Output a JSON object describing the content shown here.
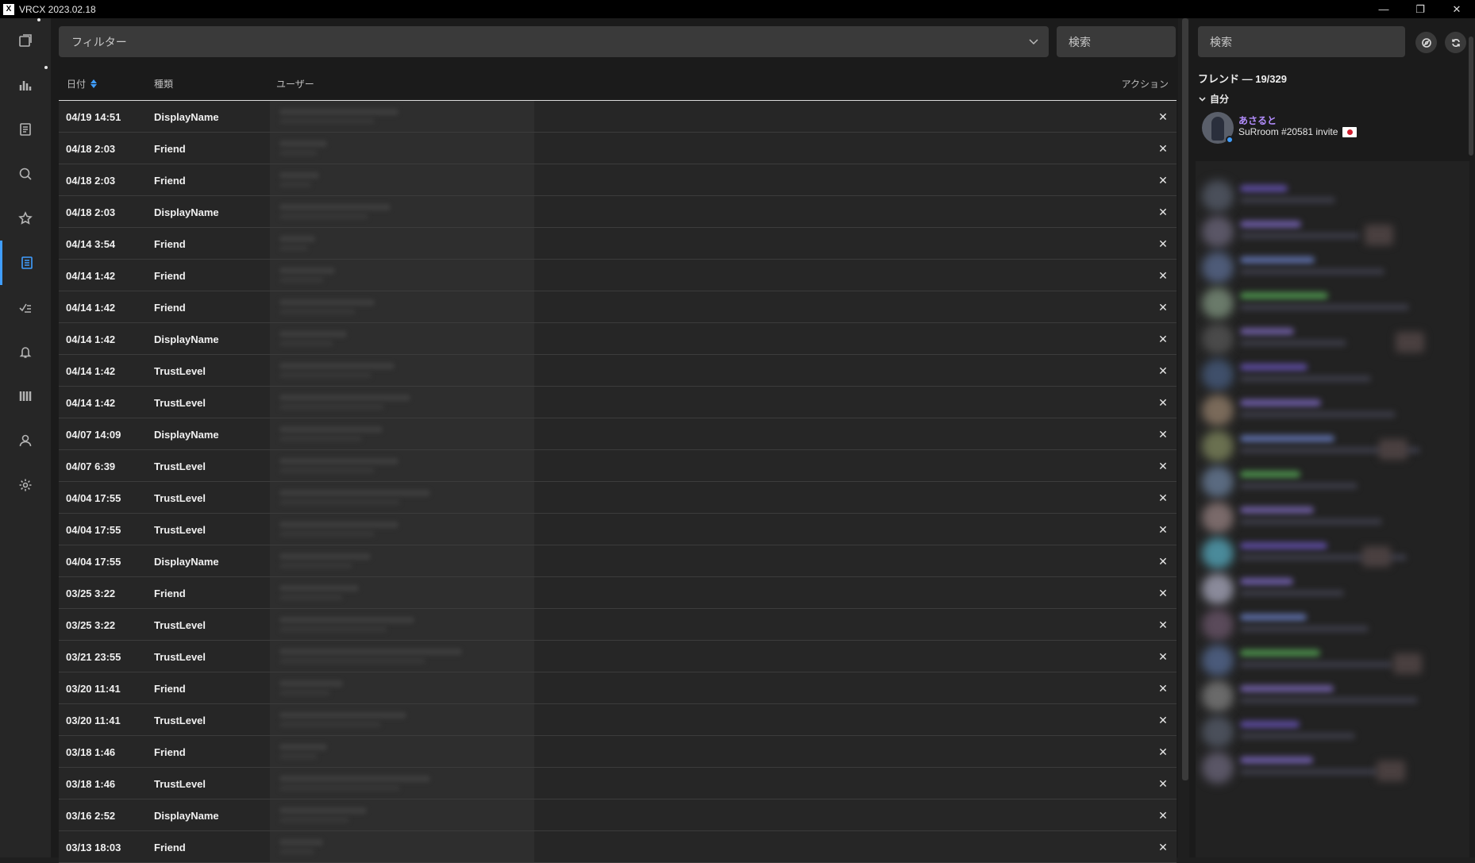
{
  "window": {
    "title": "VRCX 2023.02.18",
    "icon_letter": "X",
    "controls": {
      "minimize": "—",
      "restore": "❐",
      "close": "✕"
    }
  },
  "sidebar": {
    "items": [
      {
        "icon": "feed-icon"
      },
      {
        "icon": "chart-icon"
      },
      {
        "icon": "document-icon"
      },
      {
        "icon": "search-icon"
      },
      {
        "icon": "star-icon"
      },
      {
        "icon": "friend-log-icon",
        "active": true
      },
      {
        "icon": "moderation-icon"
      },
      {
        "icon": "bell-icon"
      },
      {
        "icon": "library-icon"
      },
      {
        "icon": "user-icon"
      },
      {
        "icon": "gear-icon"
      }
    ],
    "accent": "#409eff"
  },
  "toolbar": {
    "filter_placeholder": "フィルター",
    "search_placeholder": "検索"
  },
  "table": {
    "headers": {
      "date": "日付",
      "type": "種類",
      "user": "ユーザー",
      "action": "アクション"
    },
    "sort_column": "date",
    "close_glyph": "✕",
    "rows": [
      {
        "date": "04/19 14:51",
        "type": "DisplayName"
      },
      {
        "date": "04/18 2:03",
        "type": "Friend"
      },
      {
        "date": "04/18 2:03",
        "type": "Friend"
      },
      {
        "date": "04/18 2:03",
        "type": "DisplayName"
      },
      {
        "date": "04/14 3:54",
        "type": "Friend"
      },
      {
        "date": "04/14 1:42",
        "type": "Friend"
      },
      {
        "date": "04/14 1:42",
        "type": "Friend"
      },
      {
        "date": "04/14 1:42",
        "type": "DisplayName"
      },
      {
        "date": "04/14 1:42",
        "type": "TrustLevel"
      },
      {
        "date": "04/14 1:42",
        "type": "TrustLevel"
      },
      {
        "date": "04/07 14:09",
        "type": "DisplayName"
      },
      {
        "date": "04/07 6:39",
        "type": "TrustLevel"
      },
      {
        "date": "04/04 17:55",
        "type": "TrustLevel"
      },
      {
        "date": "04/04 17:55",
        "type": "TrustLevel"
      },
      {
        "date": "04/04 17:55",
        "type": "DisplayName"
      },
      {
        "date": "03/25 3:22",
        "type": "Friend"
      },
      {
        "date": "03/25 3:22",
        "type": "TrustLevel"
      },
      {
        "date": "03/21 23:55",
        "type": "TrustLevel"
      },
      {
        "date": "03/20 11:41",
        "type": "Friend"
      },
      {
        "date": "03/20 11:41",
        "type": "TrustLevel"
      },
      {
        "date": "03/18 1:46",
        "type": "Friend"
      },
      {
        "date": "03/18 1:46",
        "type": "TrustLevel"
      },
      {
        "date": "03/16 2:52",
        "type": "DisplayName"
      },
      {
        "date": "03/13 18:03",
        "type": "Friend"
      }
    ]
  },
  "friends_panel": {
    "search_placeholder": "検索",
    "header": "フレンド — 19/329",
    "self_group_label": "自分",
    "self": {
      "name": "あさると",
      "location": "SuRroom #20581 invite",
      "status_color": "#409eff",
      "name_color": "#b48eff"
    },
    "buttons": [
      {
        "icon": "compass-icon"
      },
      {
        "icon": "refresh-icon"
      }
    ]
  }
}
